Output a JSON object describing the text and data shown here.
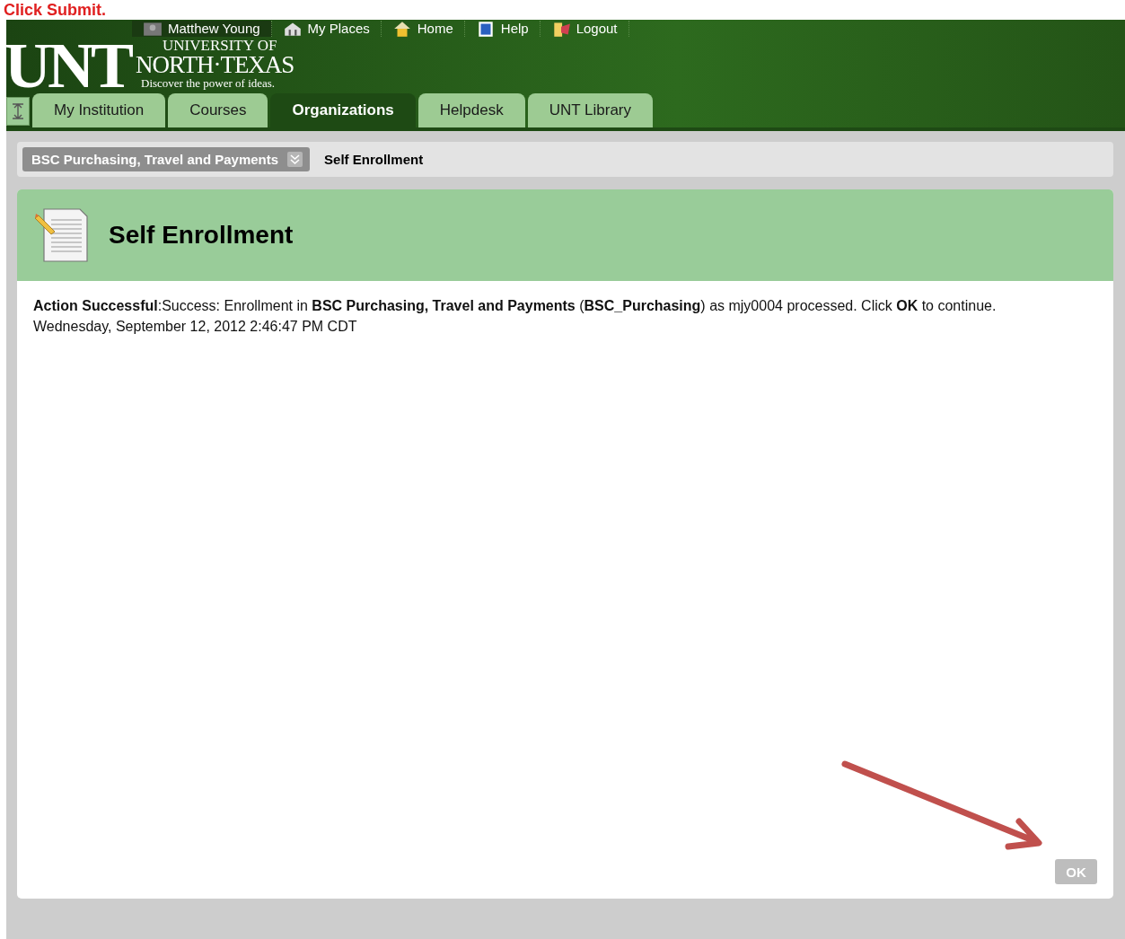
{
  "annotation": {
    "caption": "Click Submit."
  },
  "top_nav": [
    {
      "kind": "user",
      "label": "Matthew Young"
    },
    {
      "kind": "places",
      "label": "My Places"
    },
    {
      "kind": "home",
      "label": "Home"
    },
    {
      "kind": "help",
      "label": "Help"
    },
    {
      "kind": "logout",
      "label": "Logout"
    }
  ],
  "logo": {
    "mark": "UNT",
    "line1": "UNIVERSITY OF",
    "line2": "NORTH·TEXAS",
    "tagline": "Discover the power of ideas."
  },
  "tabs": [
    {
      "label": "My Institution",
      "selected": false
    },
    {
      "label": "Courses",
      "selected": false
    },
    {
      "label": "Organizations",
      "selected": true
    },
    {
      "label": "Helpdesk",
      "selected": false
    },
    {
      "label": "UNT Library",
      "selected": false
    }
  ],
  "breadcrumb": {
    "course": "BSC Purchasing, Travel and Payments",
    "current": "Self Enrollment"
  },
  "page": {
    "title": "Self Enrollment",
    "message": "**Action Successful**:Success: Enrollment in **BSC Purchasing, Travel and Payments** (**BSC_Purchasing**) as mjy0004 processed. Click **OK** to continue.",
    "timestamp": "Wednesday, September 12, 2012 2:46:47 PM CDT",
    "button": "OK"
  }
}
